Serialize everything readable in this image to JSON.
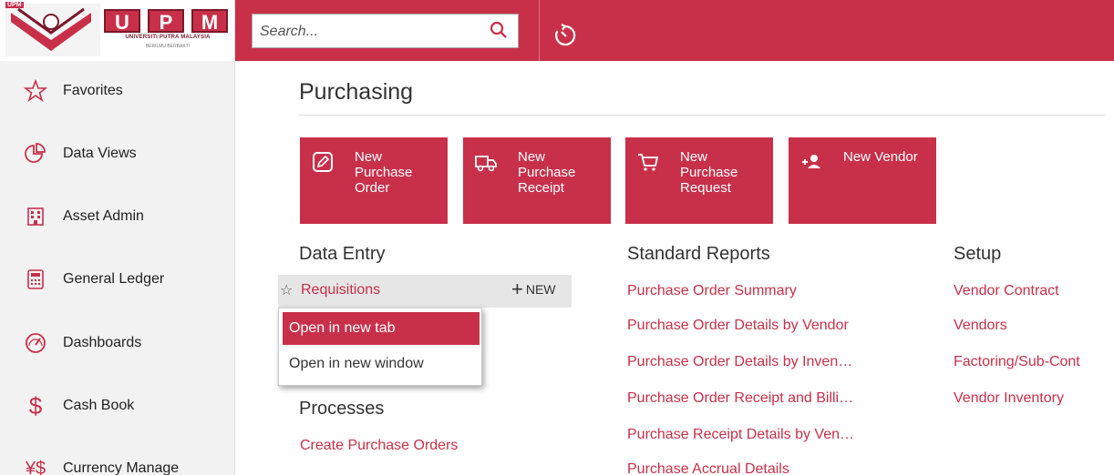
{
  "logo": {
    "tag": "UPM",
    "letters": [
      "U",
      "P",
      "M"
    ],
    "subtitle": "UNIVERSITI PUTRA MALAYSIA",
    "motto": "BERILMU BERBAKTI"
  },
  "search": {
    "placeholder": "Search..."
  },
  "colors": {
    "accent": "#c8304a",
    "sidebar_bg": "#f2f2f2"
  },
  "sidebar": {
    "items": [
      {
        "label": "Favorites",
        "icon": "star-icon"
      },
      {
        "label": "Data Views",
        "icon": "pie-chart-icon"
      },
      {
        "label": "Asset Admin",
        "icon": "building-icon"
      },
      {
        "label": "General Ledger",
        "icon": "calculator-icon"
      },
      {
        "label": "Dashboards",
        "icon": "gauge-icon"
      },
      {
        "label": "Cash Book",
        "icon": "dollar-icon"
      },
      {
        "label": "Currency Manage",
        "icon": "currency-icon"
      }
    ]
  },
  "main": {
    "title": "Purchasing",
    "tiles": [
      {
        "label": "New Purchase Order",
        "icon": "edit-icon"
      },
      {
        "label": "New Purchase Receipt",
        "icon": "truck-icon"
      },
      {
        "label": "New Purchase Request",
        "icon": "cart-icon"
      },
      {
        "label": "New Vendor",
        "icon": "add-user-icon"
      }
    ],
    "data_entry": {
      "heading": "Data Entry",
      "requisitions": "Requisitions",
      "new_label": "NEW",
      "context_menu": [
        "Open in new tab",
        "Open in new window"
      ]
    },
    "processes": {
      "heading": "Processes",
      "links": [
        "Create Purchase Orders"
      ]
    },
    "standard_reports": {
      "heading": "Standard Reports",
      "links": [
        "Purchase Order Summary",
        "Purchase Order Details by Vendor",
        "Purchase Order Details by Inven…",
        "Purchase Order Receipt and Billi…",
        "Purchase Receipt Details by Ven…",
        "Purchase Accrual Details"
      ]
    },
    "setup": {
      "heading": "Setup",
      "links": [
        "Vendor Contract",
        "Vendors",
        "Factoring/Sub-Cont",
        "Vendor Inventory"
      ]
    }
  }
}
